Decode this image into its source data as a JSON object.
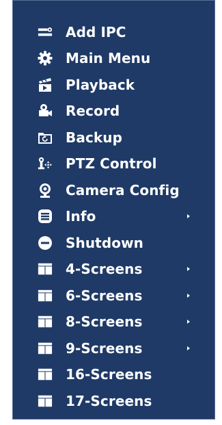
{
  "menu": {
    "items": [
      {
        "label": "Add IPC",
        "icon": "add-ipc-icon",
        "submenu": false
      },
      {
        "label": "Main Menu",
        "icon": "gear-icon",
        "submenu": false
      },
      {
        "label": "Playback",
        "icon": "playback-icon",
        "submenu": false
      },
      {
        "label": "Record",
        "icon": "record-icon",
        "submenu": false
      },
      {
        "label": "Backup",
        "icon": "backup-icon",
        "submenu": false
      },
      {
        "label": "PTZ Control",
        "icon": "ptz-icon",
        "submenu": false
      },
      {
        "label": "Camera Config",
        "icon": "camera-icon",
        "submenu": false
      },
      {
        "label": "Info",
        "icon": "info-icon",
        "submenu": true
      },
      {
        "label": "Shutdown",
        "icon": "shutdown-icon",
        "submenu": false
      },
      {
        "label": "4-Screens",
        "icon": "layout-icon",
        "submenu": true
      },
      {
        "label": "6-Screens",
        "icon": "layout-icon",
        "submenu": true
      },
      {
        "label": "8-Screens",
        "icon": "layout-icon",
        "submenu": true
      },
      {
        "label": "9-Screens",
        "icon": "layout-icon",
        "submenu": true
      },
      {
        "label": "16-Screens",
        "icon": "layout-icon",
        "submenu": false
      },
      {
        "label": "17-Screens",
        "icon": "layout-icon",
        "submenu": false
      }
    ]
  },
  "colors": {
    "menu_bg": "#1f3a66",
    "text": "#ffffff",
    "border": "#5a6f95"
  }
}
